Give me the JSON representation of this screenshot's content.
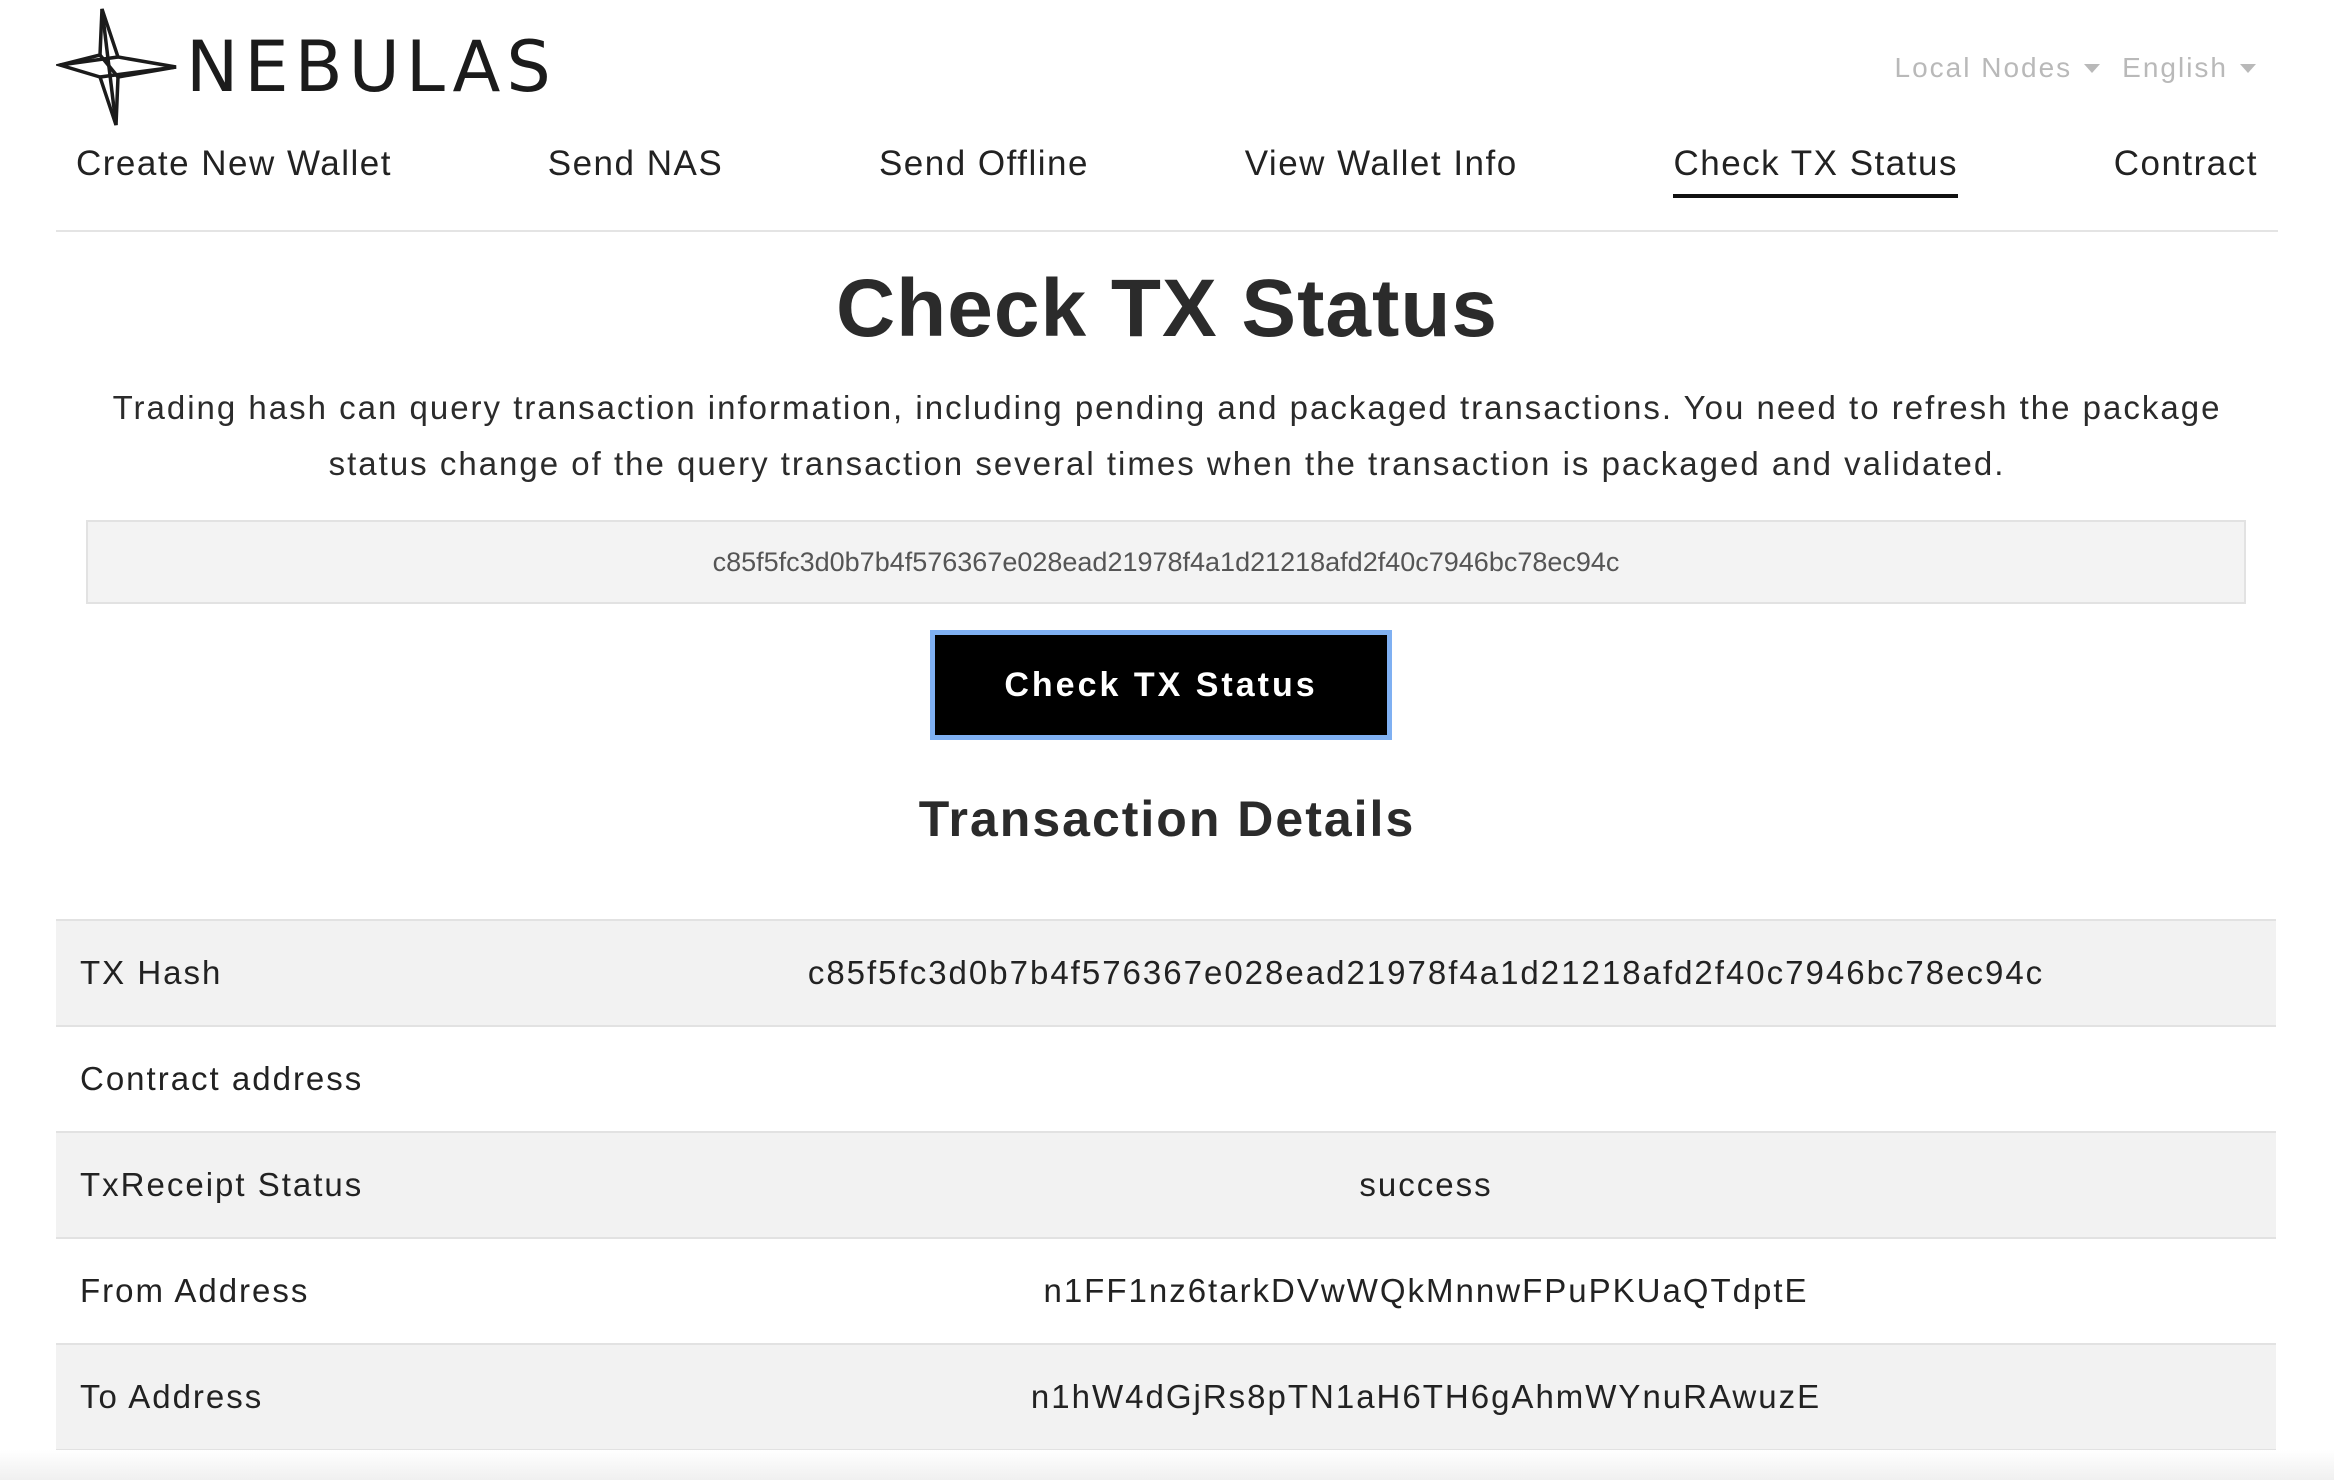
{
  "brand": {
    "name": "NEBULAS",
    "logo_icon": "nebulas-star-icon"
  },
  "topbar": {
    "node_selector": "Local Nodes",
    "language_selector": "English"
  },
  "nav": {
    "items": [
      {
        "label": "Create New Wallet"
      },
      {
        "label": "Send NAS"
      },
      {
        "label": "Send Offline"
      },
      {
        "label": "View Wallet Info"
      },
      {
        "label": "Check TX Status"
      },
      {
        "label": "Contract"
      }
    ],
    "active": "Check TX Status"
  },
  "main": {
    "title": "Check TX Status",
    "description_line1": "Trading hash can query transaction information, including pending and packaged transactions. You need to refresh the package",
    "description_line2": "status change of the query transaction several times when the transaction is packaged and validated.",
    "hash_input_value": "c85f5fc3d0b7b4f576367e028ead21978f4a1d21218afd2f40c7946bc78ec94c",
    "check_button_label": "Check TX Status",
    "details_title": "Transaction Details"
  },
  "details": {
    "rows": [
      {
        "label": "TX Hash",
        "value": "c85f5fc3d0b7b4f576367e028ead21978f4a1d21218afd2f40c7946bc78ec94c"
      },
      {
        "label": "Contract address",
        "value": ""
      },
      {
        "label": "TxReceipt Status",
        "value": "success"
      },
      {
        "label": "From Address",
        "value": "n1FF1nz6tarkDVwWQkMnnwFPuPKUaQTdptE"
      },
      {
        "label": "To Address",
        "value": "n1hW4dGjRs8pTN1aH6TH6gAhmWYnuRAwuzE"
      }
    ]
  },
  "colors": {
    "accent_focus": "#7fb0f2",
    "button_bg": "#000000",
    "row_alt_bg": "#f2f2f2"
  }
}
